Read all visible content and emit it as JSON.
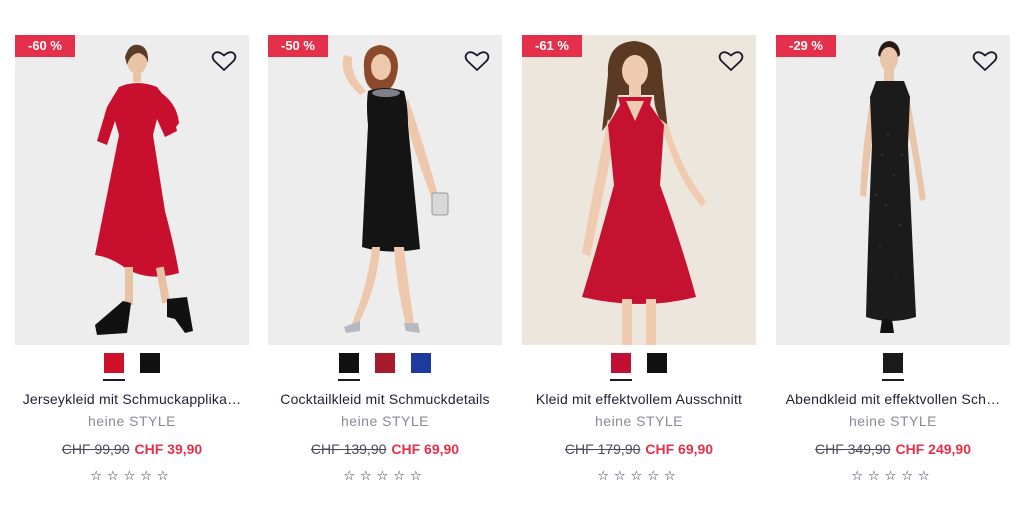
{
  "products": [
    {
      "discount": "-60 %",
      "title": "Jerseykleid mit Schmuckapplika…",
      "brand": "heine STYLE",
      "old_price": "CHF 99,90",
      "new_price": "CHF 39,90",
      "rating_stars": "☆☆☆☆☆",
      "rating": 0,
      "swatches": [
        {
          "color": "#d0102a",
          "selected": true
        },
        {
          "color": "#111111",
          "selected": false
        }
      ],
      "dress_color": "#c8102e"
    },
    {
      "discount": "-50 %",
      "title": "Cocktailkleid mit Schmuckdetails",
      "brand": "heine STYLE",
      "old_price": "CHF 139,90",
      "new_price": "CHF 69,90",
      "rating_stars": "☆☆☆☆☆",
      "rating": 0,
      "swatches": [
        {
          "color": "#111111",
          "selected": true
        },
        {
          "color": "#a61c2e",
          "selected": false
        },
        {
          "color": "#1f3a9e",
          "selected": false
        }
      ],
      "dress_color": "#141414"
    },
    {
      "discount": "-61 %",
      "title": "Kleid mit effektvollem Ausschnitt",
      "brand": "heine STYLE",
      "old_price": "CHF 179,90",
      "new_price": "CHF 69,90",
      "rating_stars": "☆☆☆☆☆",
      "rating": 0,
      "swatches": [
        {
          "color": "#c10f33",
          "selected": true
        },
        {
          "color": "#111111",
          "selected": false
        }
      ],
      "dress_color": "#c41230"
    },
    {
      "discount": "-29 %",
      "title": "Abendkleid mit effektvollen Sch…",
      "brand": "heine STYLE",
      "old_price": "CHF 349,90",
      "new_price": "CHF 249,90",
      "rating_stars": "☆☆☆☆☆",
      "rating": 0,
      "swatches": [
        {
          "color": "#1a1a1a",
          "selected": true
        }
      ],
      "dress_color": "#1b1b1b"
    }
  ],
  "colors": {
    "badge": "#e4304a",
    "sale_price": "#e4304a",
    "image_bg": "#ededee"
  }
}
